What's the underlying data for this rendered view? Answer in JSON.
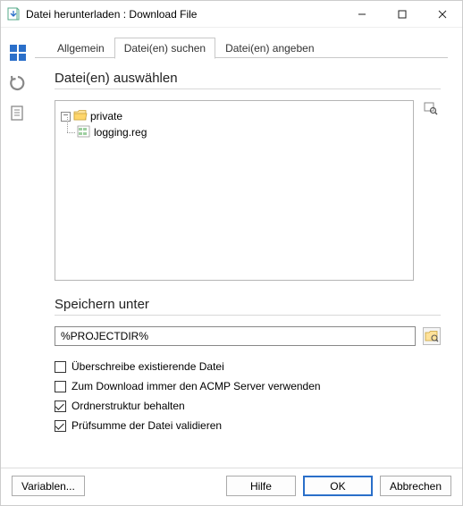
{
  "window": {
    "title": "Datei herunterladen : Download File"
  },
  "tabs": {
    "general": "Allgemein",
    "search": "Datei(en) suchen",
    "specify": "Datei(en) angeben"
  },
  "select_section": {
    "title": "Datei(en) auswählen"
  },
  "tree": {
    "root": "private",
    "child": "logging.reg"
  },
  "save_section": {
    "title": "Speichern unter",
    "path": "%PROJECTDIR%",
    "overwrite": "Überschreibe existierende Datei",
    "always_server": "Zum Download immer den ACMP Server verwenden",
    "keep_structure": "Ordnerstruktur behalten",
    "validate_checksum": "Prüfsumme der Datei validieren"
  },
  "footer": {
    "variables": "Variablen...",
    "help": "Hilfe",
    "ok": "OK",
    "cancel": "Abbrechen"
  }
}
